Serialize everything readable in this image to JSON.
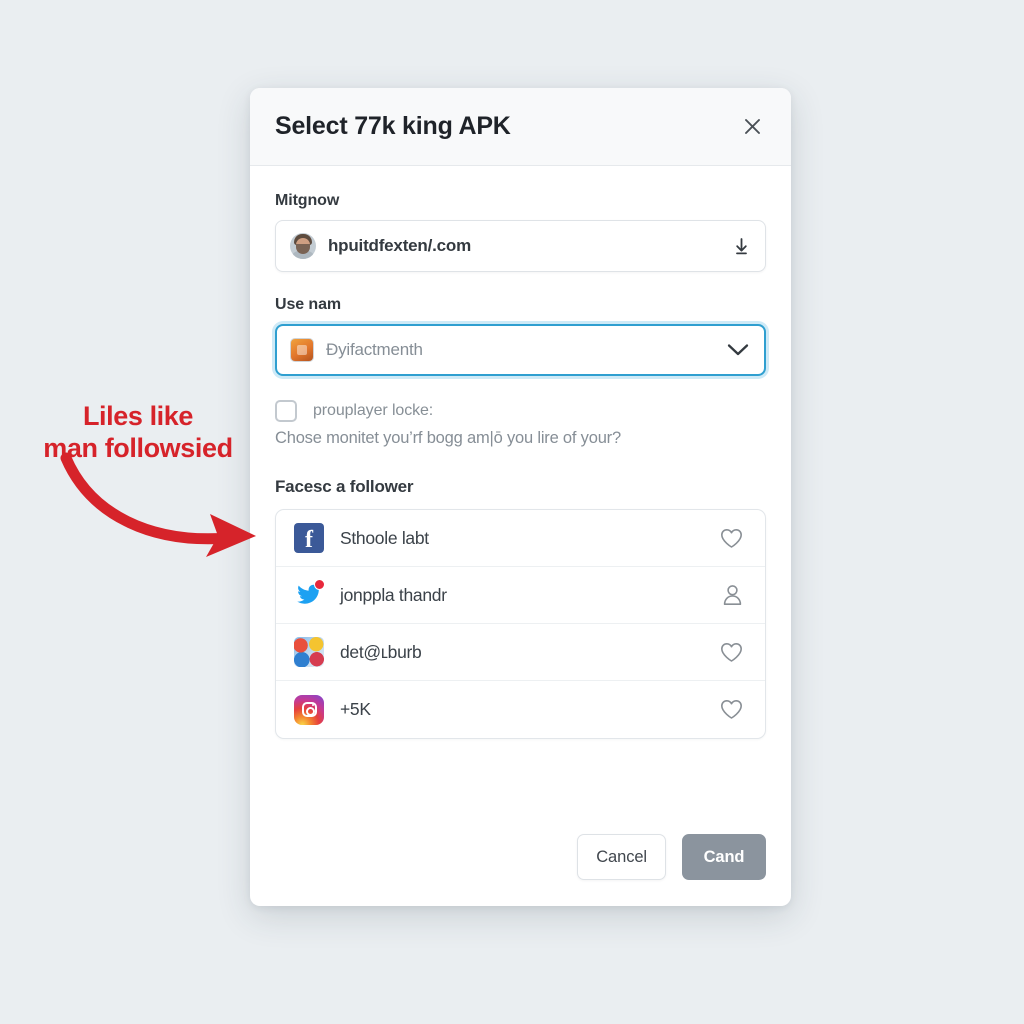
{
  "modal": {
    "title": "Select 77k king APK",
    "close_icon": "close-icon",
    "fields": [
      {
        "label": "Mitgnow",
        "value": "hpuitdfexten/.com",
        "trailing_icon": "download-arrow-icon"
      },
      {
        "label": "Use nam",
        "value": "Ðyifactmenth",
        "trailing_icon": "chevron-down-icon"
      }
    ],
    "checkbox": {
      "label": "prouplayer locke:",
      "checked": false
    },
    "help_text": "Chose monitet you’rf bogg am|ō you lire of your?",
    "list_section": {
      "title": "Facesc a follower",
      "items": [
        {
          "icon": "facebook-icon",
          "label": "Sthoole labt",
          "action_icon": "heart-icon"
        },
        {
          "icon": "twitter-icon",
          "label": "jonppla thandr",
          "action_icon": "person-icon"
        },
        {
          "icon": "app-multi-icon",
          "label": "det@ʟburb",
          "action_icon": "heart-icon"
        },
        {
          "icon": "instagram-icon",
          "label": "+5K",
          "action_icon": "heart-icon"
        }
      ]
    },
    "footer": {
      "cancel_label": "Cancel",
      "confirm_label": "Cand"
    }
  },
  "annotation": {
    "line1": "Liles like",
    "line2": "man followsied",
    "color": "#d6232a",
    "arrow_icon": "curved-arrow-right-icon"
  },
  "colors": {
    "page_background": "#eaeef1",
    "modal_background": "#ffffff",
    "header_background": "#f8f9fa",
    "focus_border": "#2f9fd0",
    "primary_button": "#8b949e",
    "annotation_red": "#d6232a",
    "facebook_blue": "#3b5998",
    "twitter_blue": "#1da1f2"
  }
}
